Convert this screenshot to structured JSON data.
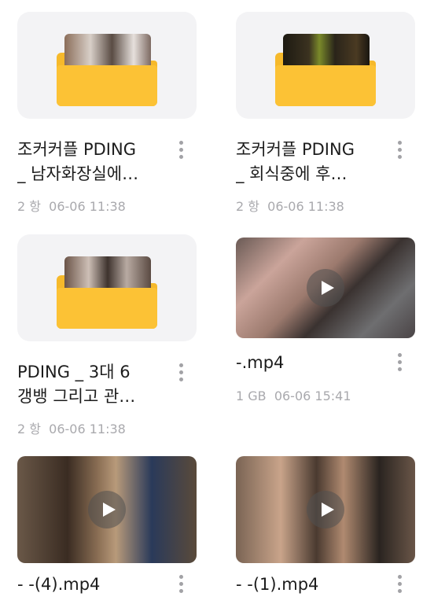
{
  "items": [
    {
      "type": "folder",
      "title_line1": "조커커플 PDING",
      "title_line2": "_ 남자화장실에…",
      "count": "2 항",
      "date": "06-06 11:38"
    },
    {
      "type": "folder",
      "title_line1": "조커커플 PDING",
      "title_line2": "_ 회식중에 후…",
      "count": "2 항",
      "date": "06-06 11:38"
    },
    {
      "type": "folder",
      "title_line1": "PDING _ 3대 6",
      "title_line2": "갱뱅 그리고 관…",
      "count": "2 항",
      "date": "06-06 11:38"
    },
    {
      "type": "video",
      "title_line1": "-.mp4",
      "size": "1 GB",
      "date": "06-06 15:41"
    },
    {
      "type": "video",
      "title_line1": "-  -(4).mp4"
    },
    {
      "type": "video",
      "title_line1": "-  -(1).mp4"
    }
  ],
  "icons": {
    "more": "more-vertical-icon",
    "play": "play-icon",
    "folder": "folder-icon"
  },
  "colors": {
    "folder": "#fcc235",
    "folder_back": "#f6b92b",
    "tile_bg": "#f3f3f5",
    "meta_text": "#a9a9ad"
  }
}
